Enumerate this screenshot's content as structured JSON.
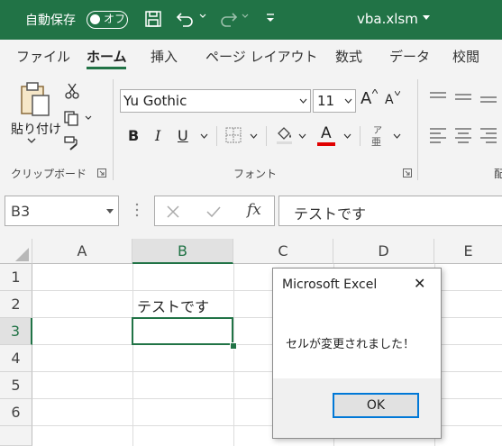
{
  "titlebar": {
    "autosave_label": "自動保存",
    "autosave_state": "オフ",
    "filename": "vba.xlsm",
    "bg_color": "#217346"
  },
  "menu_tabs": [
    {
      "label": "ファイル"
    },
    {
      "label": "ホーム",
      "active": true
    },
    {
      "label": "挿入"
    },
    {
      "label": "ページ レイアウト"
    },
    {
      "label": "数式"
    },
    {
      "label": "データ"
    },
    {
      "label": "校閲"
    }
  ],
  "ribbon": {
    "paste_label": "貼り付け",
    "clipboard_group": "クリップボード",
    "font_name": "Yu Gothic",
    "font_size": "11",
    "font_group": "フォント",
    "bold": "B",
    "italic": "I",
    "underline": "U",
    "font_color_letter": "A",
    "grow_letter": "A",
    "shrink_letter": "A",
    "phonetic_top": "ア",
    "phonetic_bottom": "亜",
    "partial_group": "配"
  },
  "formula_bar": {
    "name_box": "B3",
    "fx_label": "fx",
    "content": "テストです"
  },
  "sheet": {
    "columns": [
      "A",
      "B",
      "C",
      "D",
      "E"
    ],
    "rows": [
      "1",
      "2",
      "3",
      "4",
      "5",
      "6"
    ],
    "selected_column": "B",
    "selected_row": "3",
    "cell_b2": "テストです"
  },
  "dialog": {
    "title": "Microsoft Excel",
    "message": "セルが変更されました！",
    "ok_label": "OK",
    "close_glyph": "✕"
  },
  "colors": {
    "excel_green": "#217346",
    "font_color_underline": "#e00000",
    "dialog_focus": "#0078d7"
  }
}
